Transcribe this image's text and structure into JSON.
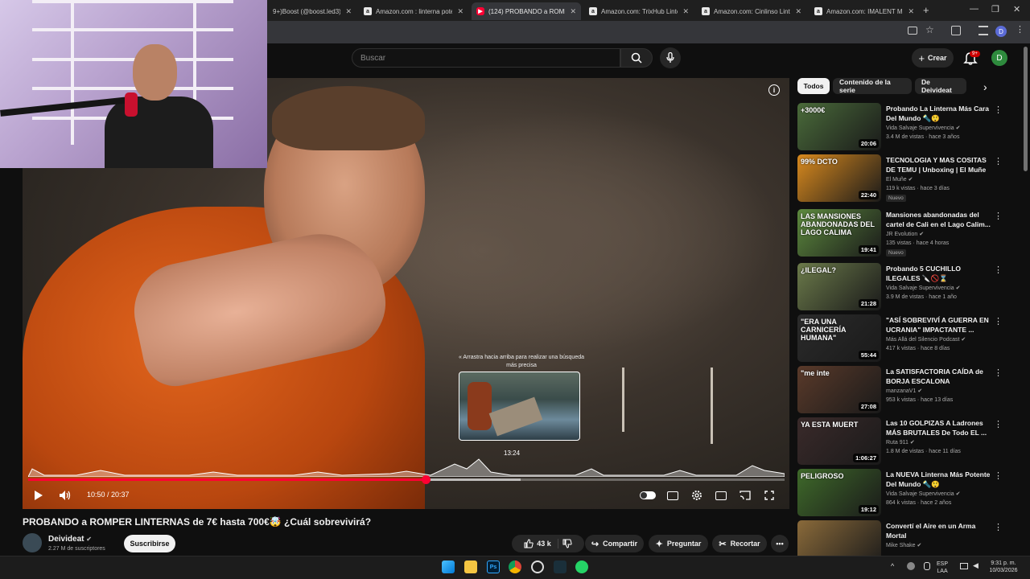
{
  "browser": {
    "tabs": [
      {
        "title": "9+)Boost (@boost.led3) | ",
        "icon": "site-icon"
      },
      {
        "title": "Amazon.com : linterna pote",
        "icon": "amazon-icon"
      },
      {
        "title": "(124) PROBANDO a ROMPER",
        "icon": "youtube-icon",
        "active": true
      },
      {
        "title": "Amazon.com: TrixHub Linter",
        "icon": "amazon-icon"
      },
      {
        "title": "Amazon.com: Cinlinso Linter",
        "icon": "amazon-icon"
      },
      {
        "title": "Amazon.com: IMALENT MS",
        "icon": "amazon-icon"
      }
    ],
    "profile_letter": "D"
  },
  "header": {
    "search_placeholder": "Buscar",
    "create_label": "Crear",
    "notifications_badge": "9+",
    "avatar_letter": "D"
  },
  "player": {
    "drag_hint": "« Arrastra hacia arriba para realizar una búsqueda más precisa",
    "preview_time": "13:24",
    "time_display": "10:50 / 20:37",
    "played_fraction": 0.5264,
    "hover_fraction": 0.6507,
    "accent": "#ff0033"
  },
  "video": {
    "title": "PROBANDO a ROMPER LINTERNAS de 7€ hasta 700€🤯 ¿Cuál sobrevivirá?",
    "channel": "Deivideat",
    "subscribers": "2.27 M de suscriptores",
    "subscribe_label": "Suscribirse",
    "likes": "43 k",
    "share_label": "Compartir",
    "ask_label": "Preguntar",
    "clip_label": "Recortar"
  },
  "sidebar": {
    "chips": [
      "Todos",
      "Contenido de la serie",
      "De Deivideat"
    ],
    "recommendations": [
      {
        "title": "Probando La Linterna Más Cara Del Mundo 🔦😲",
        "channel": "Vida Salvaje Supervivencia",
        "meta": "3.4 M de vistas · hace 3 años",
        "duration": "20:06",
        "thumb_text": "+3000€",
        "thumb_color": "#4a6b3a",
        "new": ""
      },
      {
        "title": "TECNOLOGIA Y MAS COSITAS DE TEMU | Unboxing | El Muñe",
        "channel": "El Muñe",
        "meta": "119 k vistas · hace 3 días",
        "duration": "22:40",
        "thumb_text": "99% DCTO",
        "thumb_color": "#d98a1e",
        "new": "Nuevo"
      },
      {
        "title": "Mansiones abandonadas del cartel de Cali en el Lago Calim...",
        "channel": "JR Evolution",
        "meta": "135 vistas · hace 4 horas",
        "duration": "19:41",
        "thumb_text": "LAS MANSIONES ABANDONADAS DEL LAGO CALIMA",
        "thumb_color": "#5d8a3e",
        "new": "Nuevo"
      },
      {
        "title": "Probando 5 CUCHILLO ILEGALES 🔪🚫⌛",
        "channel": "Vida Salvaje Supervivencia",
        "meta": "3.9 M de vistas · hace 1 año",
        "duration": "21:28",
        "thumb_text": "¿ILEGAL?",
        "thumb_color": "#6b7a4a",
        "new": ""
      },
      {
        "title": "\"ASÍ SOBREVIVÍ A GUERRA EN UCRANIA\" IMPACTANTE ...",
        "channel": "Más Allá del Silencio Podcast",
        "meta": "417 k vistas · hace 8 días",
        "duration": "55:44",
        "thumb_text": "\"ERA UNA CARNICERÍA HUMANA\"",
        "thumb_color": "#2b2b2b",
        "new": ""
      },
      {
        "title": "La SATISFACTORIA CAÍDA de BORJA ESCALONA",
        "channel": "manzanaV1",
        "meta": "953 k vistas · hace 13 días",
        "duration": "27:08",
        "thumb_text": "\"me inte",
        "thumb_color": "#5a3a2a",
        "new": ""
      },
      {
        "title": "Las 10 GOLPIZAS A Ladrones MÁS BRUTALES De Todo EL ...",
        "channel": "Ruta 911",
        "meta": "1.8 M de vistas · hace 11 días",
        "duration": "1:06:27",
        "thumb_text": "YA ESTA MUERT",
        "thumb_color": "#3a2a2a",
        "new": ""
      },
      {
        "title": "La NUEVA Linterna Más Potente Del Mundo 🔦😲",
        "channel": "Vida Salvaje Supervivencia",
        "meta": "864 k vistas · hace 2 años",
        "duration": "19:12",
        "thumb_text": "PELIGROSO",
        "thumb_color": "#3f6a2a",
        "new": ""
      },
      {
        "title": "Convertí el Aire en un Arma Mortal",
        "channel": "Mike Shake",
        "meta": "",
        "duration": "",
        "thumb_text": "",
        "thumb_color": "#8a6a3a",
        "new": ""
      }
    ]
  },
  "taskbar": {
    "lang": "ESP\nLAA",
    "time": "9:31 p. m.",
    "date": "10/03/2026"
  }
}
